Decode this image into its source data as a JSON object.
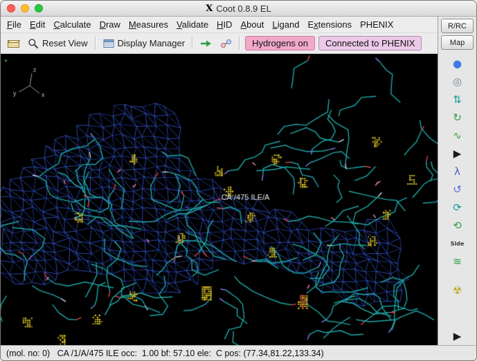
{
  "window": {
    "title": "Coot 0.8.9 EL",
    "title_icon": "X"
  },
  "menu_bar": {
    "items": [
      {
        "label": "File",
        "accel_index": 0
      },
      {
        "label": "Edit",
        "accel_index": 0
      },
      {
        "label": "Calculate",
        "accel_index": 0
      },
      {
        "label": "Draw",
        "accel_index": 0
      },
      {
        "label": "Measures",
        "accel_index": 0
      },
      {
        "label": "Validate",
        "accel_index": 0
      },
      {
        "label": "HID",
        "accel_index": 0
      },
      {
        "label": "About",
        "accel_index": 0
      },
      {
        "label": "Ligand",
        "accel_index": 0
      },
      {
        "label": "Extensions",
        "accel_index": 1
      },
      {
        "label": "PHENIX",
        "accel_index": -1
      }
    ]
  },
  "toolbar": {
    "reset_view_label": "Reset View",
    "display_manager_label": "Display Manager",
    "hydrogens_button": {
      "label": "Hydrogens on",
      "bg": "#f2a9c9",
      "border": "#c77ba2"
    },
    "phenix_button": {
      "label": "Connected to PHENIX",
      "bg": "#ecc9e8",
      "border": "#b48cb0"
    }
  },
  "side_panel": {
    "rrc_label": "R/RC",
    "map_label": "Map",
    "icons": [
      {
        "name": "sphere-refine-icon",
        "glyph": "●",
        "color": "#3b7de0"
      },
      {
        "name": "globe-icon",
        "glyph": "◎",
        "color": "#6f7f90"
      },
      {
        "name": "rigid-body-fit-icon",
        "glyph": "⇅",
        "color": "#159aa0"
      },
      {
        "name": "rotate-translate-icon",
        "glyph": "↻",
        "color": "#2f9e44"
      },
      {
        "name": "auto-fit-rotamer-icon",
        "glyph": "∿",
        "color": "#2f9e44"
      },
      {
        "name": "expand-tools-icon",
        "glyph": "▶",
        "color": "#1a1a1a"
      },
      {
        "name": "rotamers-icon",
        "glyph": "λ",
        "color": "#4a5fd0"
      },
      {
        "name": "edit-chi-angles-icon",
        "glyph": "↺",
        "color": "#5a6ee0"
      },
      {
        "name": "torsion-general-icon",
        "glyph": "⟳",
        "color": "#159aa0"
      },
      {
        "name": "flip-peptide-icon",
        "glyph": "⟲",
        "color": "#2f9e44"
      },
      {
        "name": "side-chain-flip-icon",
        "glyph": "Side",
        "color": "#333333",
        "text": true
      },
      {
        "name": "jed-flip-icon",
        "glyph": "≋",
        "color": "#2f9e44"
      },
      {
        "name": "radiation-rotamer-icon",
        "glyph": "☢",
        "color": "#c2a818",
        "gap_before": true
      },
      {
        "name": "more-tools-arrow-icon",
        "glyph": "▶",
        "color": "#1a1a1a",
        "pin": "bottom"
      }
    ]
  },
  "viewport": {
    "background": "#000000",
    "atom_label": "CA /475 ILE/A",
    "axes": [
      "x",
      "y",
      "z"
    ],
    "mesh_color": "#3c64f0",
    "mesh_color_dim": "#2a46b4",
    "stick_color": "#1fa8a8",
    "oxygen_color": "#e04545",
    "nitrogen_color": "#8585f0",
    "highlight_color": "#d9d9ec",
    "sulfur_dot_color": "#d9c427",
    "sulfur_dot_dim": "#a89410",
    "marker_color": "#f07fb0",
    "label_color": "#e8e8e8"
  },
  "status_bar": {
    "text": "(mol. no: 0)   CA /1/A/475 ILE occ:  1.00 bf: 57.10 ele:  C pos: (77.34,81.22,133.34)"
  }
}
